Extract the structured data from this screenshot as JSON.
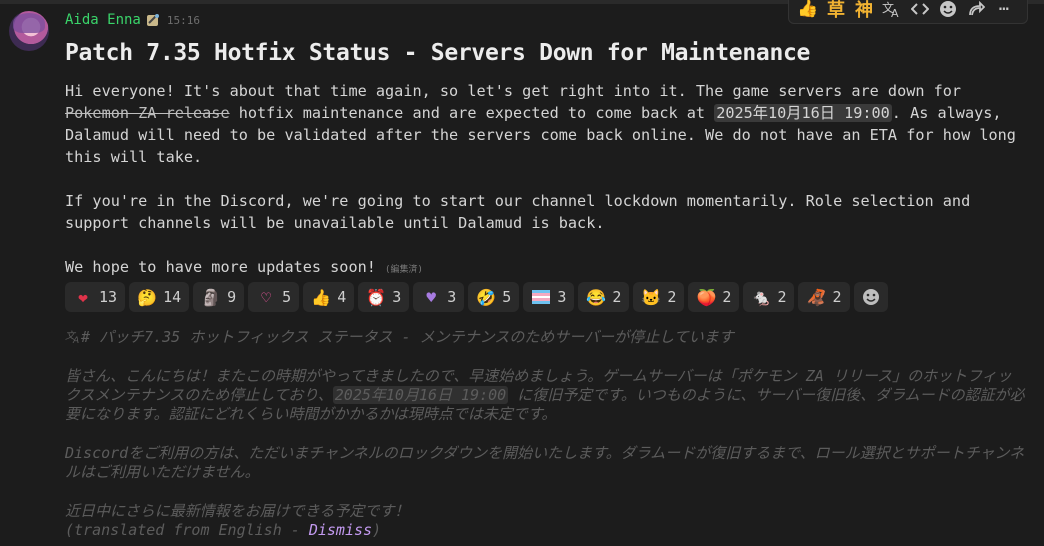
{
  "author": {
    "name": "Aida Enna",
    "timestamp": "15:16"
  },
  "toolbar": {
    "react1": "草",
    "react2": "神"
  },
  "message": {
    "title": "Patch 7.35 Hotfix Status - Servers Down for Maintenance",
    "p1_a": "Hi everyone! It's about that time again, so let's get right into it. The game servers are down for ",
    "p1_strike": "Pokemon ZA release",
    "p1_b": " hotfix maintenance and are expected to come back at ",
    "p1_time": "2025年10月16日 19:00",
    "p1_c": ". As always, Dalamud will need to be validated after the servers come back online. We do not have an ETA for how long this will take.",
    "p2": "If you're in the Discord, we're going to start our channel lockdown momentarily. Role selection and support channels will be unavailable until Dalamud is back.",
    "p3": "We hope to have more updates soon!",
    "edited": "(編集済)"
  },
  "reactions": [
    {
      "emoji": "❤",
      "color": "#e0334a",
      "count": "13"
    },
    {
      "emoji": "🤔",
      "color": "#f2b33a",
      "count": "14"
    },
    {
      "emoji": "🗿",
      "color": "#9a9a9a",
      "count": "9"
    },
    {
      "emoji": "♡",
      "color": "#ff5aa8",
      "count": "5"
    },
    {
      "emoji": "👍",
      "color": "#f2b33a",
      "count": "4"
    },
    {
      "emoji": "⏰",
      "color": "#d13b3b",
      "count": "3"
    },
    {
      "emoji": "♥",
      "color": "#a77be0",
      "count": "3"
    },
    {
      "emoji": "🤣",
      "color": "#f2b33a",
      "count": "5"
    },
    {
      "emoji": "🏳",
      "color": "#6ec2f0",
      "count": "3"
    },
    {
      "emoji": "😂",
      "color": "#f2b33a",
      "count": "2"
    },
    {
      "emoji": "🐱",
      "color": "#d08a4a",
      "count": "2"
    },
    {
      "emoji": "🍑",
      "color": "#e86b9a",
      "count": "2"
    },
    {
      "emoji": "🐁",
      "color": "#c7b3c7",
      "count": "2"
    },
    {
      "emoji": "🦧",
      "color": "#b07a3a",
      "count": "2"
    }
  ],
  "translation": {
    "title": "# パッチ7.35 ホットフィックス ステータス - メンテナンスのためサーバーが停止しています",
    "t1_a": "皆さん、こんにちは！またこの時期がやってきましたので、早速始めましょう。ゲームサーバーは「ポケモン ZA リリース」のホットフィックスメンテナンスのため停止しており、",
    "t1_time": "2025年10月16日 19:00",
    "t1_b": " に復旧予定です。いつものように、サーバー復旧後、ダラムードの認証が必要になります。認証にどれくらい時間がかかるかは現時点では未定です。",
    "t2": "Discordをご利用の方は、ただいまチャンネルのロックダウンを開始いたします。ダラムードが復旧するまで、ロール選択とサポートチャンネルはご利用いただけません。",
    "t3": "近日中にさらに最新情報をお届けできる予定です！",
    "footer_a": "(translated from English - ",
    "dismiss": "Dismiss",
    "footer_b": ")"
  }
}
